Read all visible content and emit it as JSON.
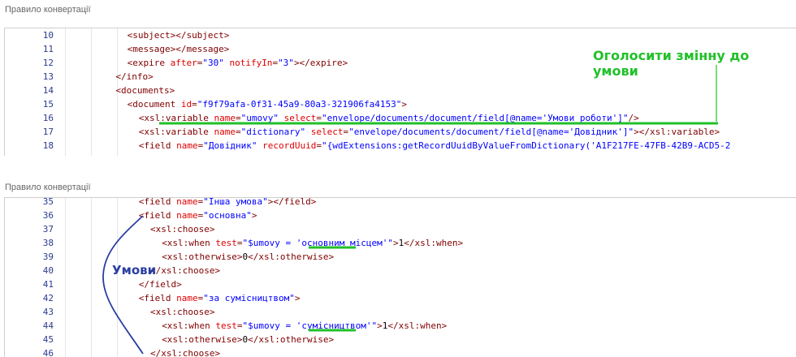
{
  "panels": [
    {
      "title": "Правило конвертації",
      "lines": [
        {
          "n": "10",
          "indent": 6,
          "tokens": [
            [
              "tag",
              "<subject></subject>"
            ]
          ]
        },
        {
          "n": "11",
          "indent": 6,
          "tokens": [
            [
              "tag",
              "<message></message>"
            ]
          ]
        },
        {
          "n": "12",
          "indent": 6,
          "tokens": [
            [
              "tag",
              "<expire "
            ],
            [
              "attr",
              "after"
            ],
            [
              "tag",
              "="
            ],
            [
              "val",
              "\"30\""
            ],
            [
              "tag",
              " "
            ],
            [
              "attr",
              "notifyIn"
            ],
            [
              "tag",
              "="
            ],
            [
              "val",
              "\"3\""
            ],
            [
              "tag",
              "></expire>"
            ]
          ]
        },
        {
          "n": "13",
          "indent": 4,
          "tokens": [
            [
              "tag",
              "</info>"
            ]
          ]
        },
        {
          "n": "14",
          "indent": 4,
          "tokens": [
            [
              "tag",
              "<documents>"
            ]
          ]
        },
        {
          "n": "15",
          "indent": 6,
          "tokens": [
            [
              "tag",
              "<document "
            ],
            [
              "attr",
              "id"
            ],
            [
              "tag",
              "="
            ],
            [
              "val",
              "\"f9f79afa-0f31-45a9-80a3-321906fa4153\""
            ],
            [
              "tag",
              ">"
            ]
          ]
        },
        {
          "n": "16",
          "indent": 8,
          "tokens": [
            [
              "tag",
              "<xsl:variable "
            ],
            [
              "attr",
              "name"
            ],
            [
              "tag",
              "="
            ],
            [
              "val",
              "\"umovy\""
            ],
            [
              "tag",
              " "
            ],
            [
              "attr",
              "select"
            ],
            [
              "tag",
              "="
            ],
            [
              "val",
              "\"envelope/documents/document/field[@name='Умови роботи']\""
            ],
            [
              "tag",
              "/>"
            ]
          ]
        },
        {
          "n": "17",
          "indent": 8,
          "tokens": [
            [
              "tag",
              "<xsl:variable "
            ],
            [
              "attr",
              "name"
            ],
            [
              "tag",
              "="
            ],
            [
              "val",
              "\"dictionary\""
            ],
            [
              "tag",
              " "
            ],
            [
              "attr",
              "select"
            ],
            [
              "tag",
              "="
            ],
            [
              "val",
              "\"envelope/documents/document/field[@name='Довідник']\""
            ],
            [
              "tag",
              "></xsl:variable>"
            ]
          ]
        },
        {
          "n": "18",
          "indent": 8,
          "tokens": [
            [
              "tag",
              "<field "
            ],
            [
              "attr",
              "name"
            ],
            [
              "tag",
              "="
            ],
            [
              "val",
              "\"Довідник\""
            ],
            [
              "tag",
              " "
            ],
            [
              "attr",
              "recordUuid"
            ],
            [
              "tag",
              "="
            ],
            [
              "val",
              "\"{wdExtensions:getRecordUuidByValueFromDictionary('A1F217FE-47FB-42B9-ACD5-2"
            ]
          ]
        }
      ]
    },
    {
      "title": "Правило конвертації",
      "lines": [
        {
          "n": "35",
          "indent": 8,
          "tokens": [
            [
              "tag",
              "<field "
            ],
            [
              "attr",
              "name"
            ],
            [
              "tag",
              "="
            ],
            [
              "val",
              "\"Інша умова\""
            ],
            [
              "tag",
              "></field>"
            ]
          ]
        },
        {
          "n": "36",
          "indent": 8,
          "tokens": [
            [
              "tag",
              "<field "
            ],
            [
              "attr",
              "name"
            ],
            [
              "tag",
              "="
            ],
            [
              "val",
              "\"основна\""
            ],
            [
              "tag",
              ">"
            ]
          ]
        },
        {
          "n": "37",
          "indent": 10,
          "tokens": [
            [
              "tag",
              "<xsl:choose>"
            ]
          ]
        },
        {
          "n": "38",
          "indent": 12,
          "tokens": [
            [
              "tag",
              "<xsl:when "
            ],
            [
              "attr",
              "test"
            ],
            [
              "tag",
              "="
            ],
            [
              "val",
              "\"$umovy = 'основним місцем'\""
            ],
            [
              "tag",
              ">"
            ],
            [
              "txt",
              "1"
            ],
            [
              "tag",
              "</xsl:when>"
            ]
          ]
        },
        {
          "n": "39",
          "indent": 12,
          "tokens": [
            [
              "tag",
              "<xsl:otherwise>"
            ],
            [
              "txt",
              "0"
            ],
            [
              "tag",
              "</xsl:otherwise>"
            ]
          ]
        },
        {
          "n": "40",
          "indent": 10,
          "tokens": [
            [
              "tag",
              "</xsl:choose>"
            ]
          ]
        },
        {
          "n": "41",
          "indent": 8,
          "tokens": [
            [
              "tag",
              "</field>"
            ]
          ]
        },
        {
          "n": "42",
          "indent": 8,
          "tokens": [
            [
              "tag",
              "<field "
            ],
            [
              "attr",
              "name"
            ],
            [
              "tag",
              "="
            ],
            [
              "val",
              "\"за сумісництвом\""
            ],
            [
              "tag",
              ">"
            ]
          ]
        },
        {
          "n": "43",
          "indent": 10,
          "tokens": [
            [
              "tag",
              "<xsl:choose>"
            ]
          ]
        },
        {
          "n": "44",
          "indent": 12,
          "tokens": [
            [
              "tag",
              "<xsl:when "
            ],
            [
              "attr",
              "test"
            ],
            [
              "tag",
              "="
            ],
            [
              "val",
              "\"$umovy = 'сумісництвом'\""
            ],
            [
              "tag",
              ">"
            ],
            [
              "txt",
              "1"
            ],
            [
              "tag",
              "</xsl:when>"
            ]
          ]
        },
        {
          "n": "45",
          "indent": 12,
          "tokens": [
            [
              "tag",
              "<xsl:otherwise>"
            ],
            [
              "txt",
              "0"
            ],
            [
              "tag",
              "</xsl:otherwise>"
            ]
          ]
        },
        {
          "n": "46",
          "indent": 10,
          "tokens": [
            [
              "tag",
              "</xsl:choose>"
            ]
          ]
        }
      ]
    }
  ],
  "annotations": {
    "declare_variable": "Оголосити змінну до умови",
    "conditions": "Умови"
  },
  "colors": {
    "tag": "#800000",
    "attribute": "#e00000",
    "value": "#0000ff",
    "line_number": "#2b3a8f",
    "annotation_green": "#22c02a",
    "annotation_blue": "#2a3fa0"
  }
}
